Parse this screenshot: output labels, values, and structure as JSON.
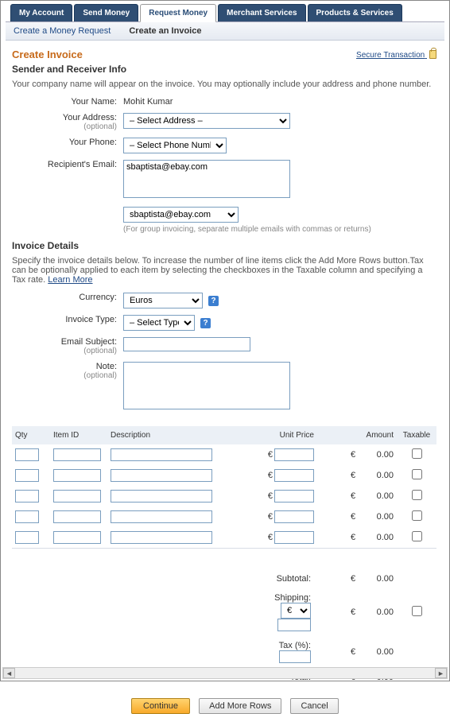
{
  "tabs": {
    "my_account": "My Account",
    "send_money": "Send Money",
    "request_money": "Request Money",
    "merchant_services": "Merchant Services",
    "products_services": "Products & Services"
  },
  "subtabs": {
    "create_request": "Create a Money Request",
    "create_invoice": "Create an Invoice"
  },
  "secure_link": "Secure Transaction",
  "page_title": "Create Invoice",
  "section1_title": "Sender and Receiver Info",
  "section1_hint": "Your company name will appear on the invoice. You may optionally include your address and phone number.",
  "labels": {
    "your_name": "Your Name:",
    "your_address": "Your Address:",
    "your_phone": "Your Phone:",
    "recipient_email": "Recipient's Email:",
    "currency": "Currency:",
    "invoice_type": "Invoice Type:",
    "email_subject": "Email Subject:",
    "note": "Note:",
    "optional": "(optional)"
  },
  "values": {
    "your_name": "Mohit Kumar",
    "address_option": "– Select Address –",
    "phone_option": "– Select Phone Number –",
    "recipient_email_text": "sbaptista@ebay.com",
    "recipient_dropdown": "sbaptista@ebay.com",
    "group_note": "(For group invoicing, separate multiple emails with commas or returns)",
    "currency_option": "Euros",
    "invoice_type_option": "– Select Type –"
  },
  "section2_title": "Invoice Details",
  "section2_hint_a": "Specify the invoice details below. To increase the number of line items click the Add More Rows button.Tax can be optionally applied to each item by selecting the checkboxes in the Taxable column and specifying a Tax rate. ",
  "learn_more": "Learn More",
  "table": {
    "headers": {
      "qty": "Qty",
      "item_id": "Item ID",
      "description": "Description",
      "unit_price": "Unit Price",
      "amount": "Amount",
      "taxable": "Taxable"
    },
    "currency_symbol": "€",
    "zero": "0.00",
    "rows": [
      0,
      1,
      2,
      3,
      4
    ]
  },
  "summary": {
    "subtotal": "Subtotal:",
    "shipping": "Shipping:",
    "tax": "Tax (%):",
    "total": "Total:",
    "euro": "€",
    "zero": "0.00",
    "ship_opt": "€"
  },
  "buttons": {
    "continue": "Continue",
    "add_rows": "Add More Rows",
    "cancel": "Cancel"
  }
}
